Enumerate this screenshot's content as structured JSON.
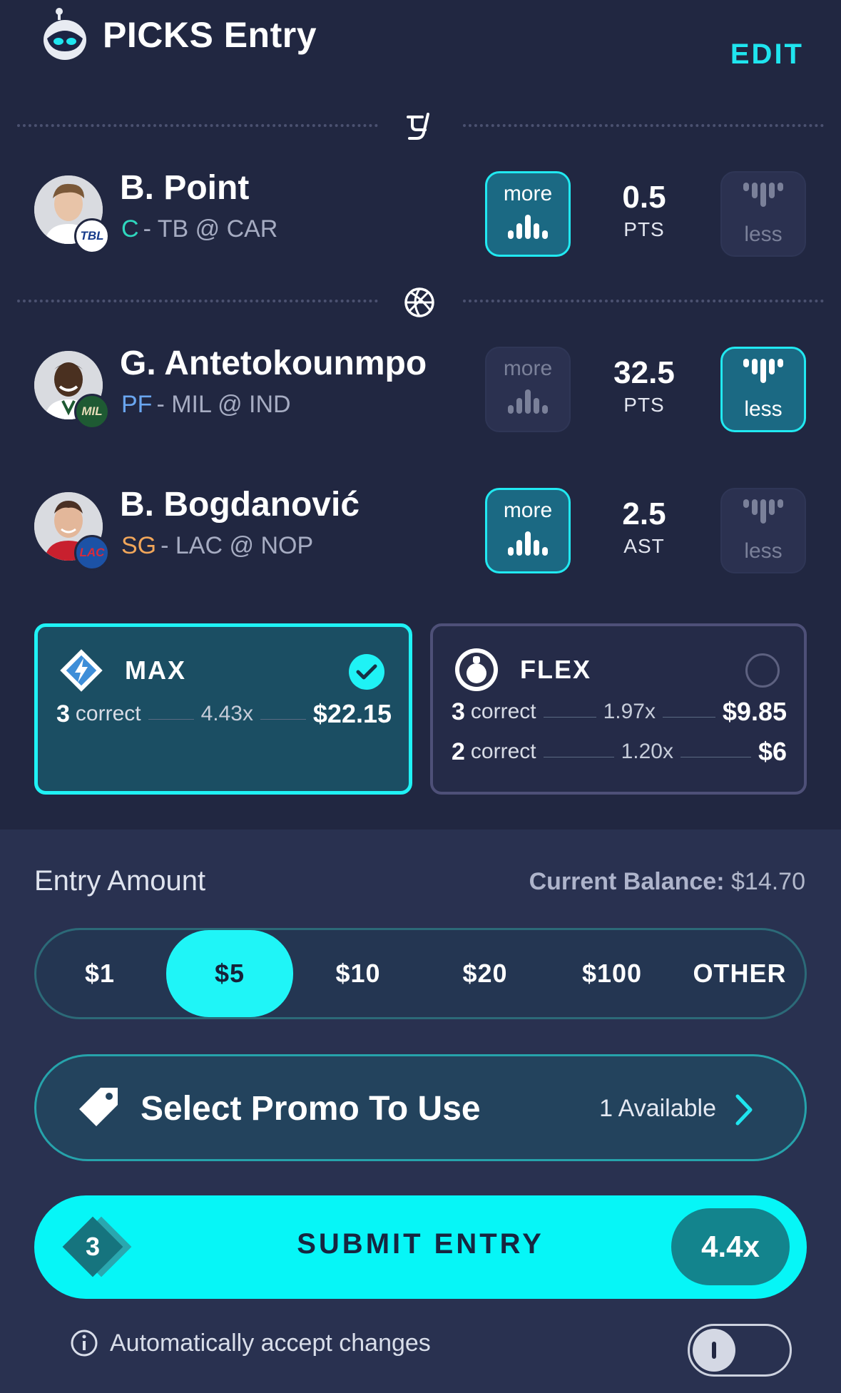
{
  "header": {
    "title": "PICKS Entry",
    "edit_label": "EDIT"
  },
  "picks": [
    {
      "name": "B. Point",
      "position": "C",
      "position_color": "#2fd7be",
      "matchup": "- TB @ CAR",
      "team_abbr": "TBL",
      "team_color": "#ffffff",
      "team_text_color": "#163a8a",
      "line": "0.5",
      "stat": "PTS",
      "more_label": "more",
      "less_label": "less",
      "selected": "more"
    },
    {
      "name": "G. Antetokounmpo",
      "position": "PF",
      "position_color": "#6aa6f0",
      "matchup": "- MIL @ IND",
      "team_abbr": "MIL",
      "team_color": "#1e5a33",
      "team_text_color": "#e7dcb8",
      "line": "32.5",
      "stat": "PTS",
      "more_label": "more",
      "less_label": "less",
      "selected": "less"
    },
    {
      "name": "B. Bogdanović",
      "position": "SG",
      "position_color": "#f1a65a",
      "matchup": "- LAC @ NOP",
      "team_abbr": "LAC",
      "team_color": "#1c52a6",
      "team_text_color": "#d92b3a",
      "line": "2.5",
      "stat": "AST",
      "more_label": "more",
      "less_label": "less",
      "selected": "more"
    }
  ],
  "play_types": {
    "max": {
      "name": "MAX",
      "selected": true,
      "payouts": [
        {
          "count": "3",
          "word": "correct",
          "multiplier": "4.43x",
          "amount": "$22.15"
        }
      ]
    },
    "flex": {
      "name": "FLEX",
      "selected": false,
      "payouts": [
        {
          "count": "3",
          "word": "correct",
          "multiplier": "1.97x",
          "amount": "$9.85"
        },
        {
          "count": "2",
          "word": "correct",
          "multiplier": "1.20x",
          "amount": "$6"
        }
      ]
    }
  },
  "entry": {
    "label": "Entry Amount",
    "balance_label": "Current Balance:",
    "balance_value": "$14.70",
    "amounts": [
      "$1",
      "$5",
      "$10",
      "$20",
      "$100",
      "OTHER"
    ],
    "selected_amount": "$5"
  },
  "promo": {
    "title": "Select Promo To Use",
    "available": "1 Available"
  },
  "submit": {
    "count": "3",
    "label": "SUBMIT ENTRY",
    "multiplier": "4.4x"
  },
  "auto_accept": {
    "label": "Automatically accept changes",
    "enabled": false
  },
  "colors": {
    "background": "#212741",
    "accent": "#1ff2f5",
    "panel": "#293150"
  }
}
